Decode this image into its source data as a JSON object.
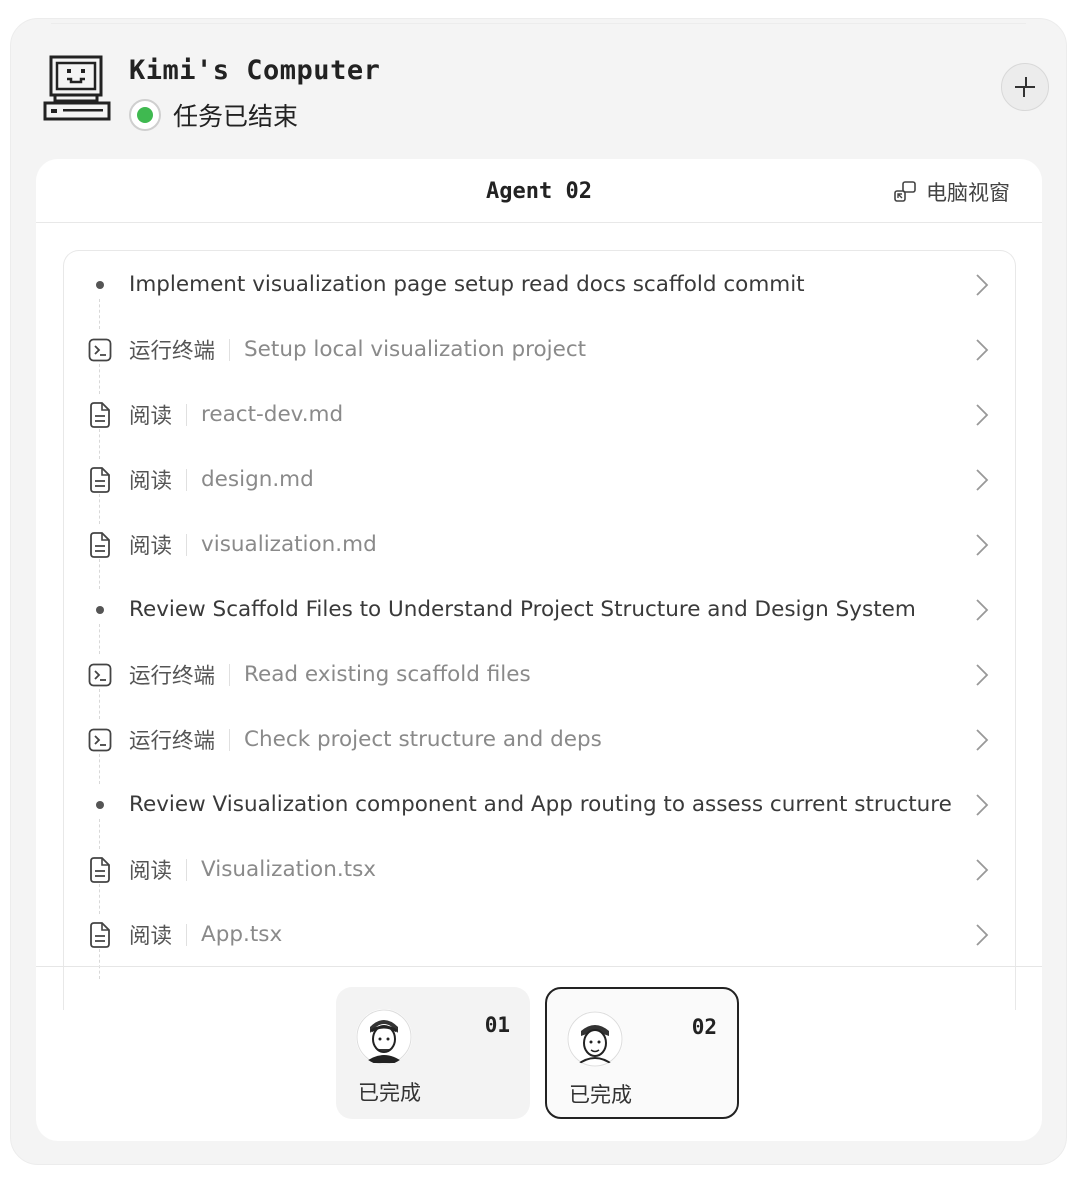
{
  "header": {
    "title": "Kimi's Computer",
    "status": "任务已结束",
    "status_color": "#3fb950"
  },
  "panel": {
    "agent_name": "Agent 02",
    "view_link": "电脑视窗"
  },
  "steps": [
    {
      "kind": "bullet",
      "title": "Implement visualization page setup read docs scaffold commit"
    },
    {
      "kind": "terminal",
      "icon": "terminal-icon",
      "action": "运行终端",
      "detail": "Setup local visualization project"
    },
    {
      "kind": "file",
      "icon": "document-icon",
      "action": "阅读",
      "detail": "react-dev.md"
    },
    {
      "kind": "file",
      "icon": "document-icon",
      "action": "阅读",
      "detail": "design.md"
    },
    {
      "kind": "file",
      "icon": "document-icon",
      "action": "阅读",
      "detail": "visualization.md"
    },
    {
      "kind": "bullet",
      "title": "Review Scaffold Files to Understand Project Structure and Design System"
    },
    {
      "kind": "terminal",
      "icon": "terminal-icon",
      "action": "运行终端",
      "detail": "Read existing scaffold files"
    },
    {
      "kind": "terminal",
      "icon": "terminal-icon",
      "action": "运行终端",
      "detail": "Check project structure and deps"
    },
    {
      "kind": "bullet",
      "title": "Review Visualization component and App routing to assess current structure"
    },
    {
      "kind": "file",
      "icon": "document-icon",
      "action": "阅读",
      "detail": "Visualization.tsx"
    },
    {
      "kind": "file",
      "icon": "document-icon",
      "action": "阅读",
      "detail": "App.tsx"
    }
  ],
  "agents": [
    {
      "number": "01",
      "state": "已完成",
      "active": false
    },
    {
      "number": "02",
      "state": "已完成",
      "active": true
    }
  ]
}
